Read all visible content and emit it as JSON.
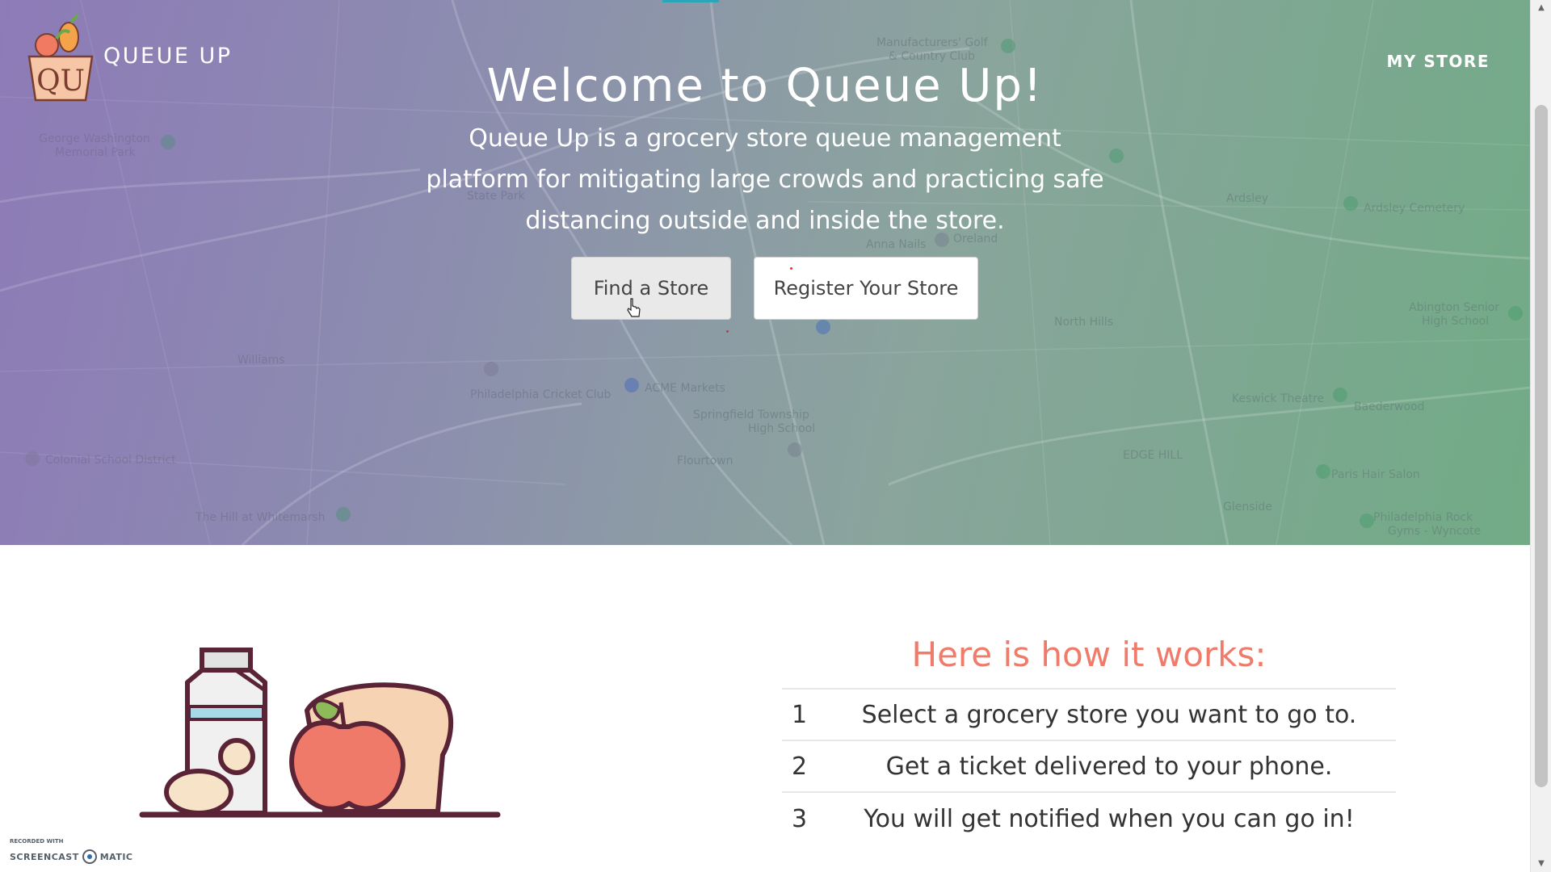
{
  "brand": {
    "name": "QUEUE UP",
    "logo_text": "QU"
  },
  "nav": {
    "my_store": "MY STORE"
  },
  "hero": {
    "title": "Welcome to Queue Up!",
    "description_lines": [
      "Queue Up is a grocery store queue management",
      "platform for mitigating large crowds and practicing safe",
      "distancing outside and inside the store."
    ],
    "buttons": {
      "find": "Find a Store",
      "register": "Register Your Store"
    }
  },
  "map_labels": [
    "Manufacturers' Golf & Country Club",
    "George Washington Memorial Park",
    "State Park",
    "Anna Nails",
    "Oreland",
    "Ardsley",
    "Ardsley Cemetery",
    "North Hills",
    "Abington Senior High School",
    "Williams",
    "Philadelphia Cricket Club",
    "ACME Markets",
    "Springfield Township High School",
    "Keswick Theatre",
    "Baederwood",
    "Colonial School District",
    "Flourtown",
    "EDGE HILL",
    "Paris Hair Salon",
    "Glenside",
    "The Hill at Whitemarsh",
    "Philadelphia Rock Gyms - Wyncote"
  ],
  "how_it_works": {
    "title": "Here is how it works:",
    "steps": [
      {
        "num": "1",
        "text": "Select a grocery store you want to go to."
      },
      {
        "num": "2",
        "text": "Get a ticket delivered to your phone."
      },
      {
        "num": "3",
        "text": "You will get notified when you can go in!"
      }
    ]
  },
  "watermark": {
    "top": "RECORDED WITH",
    "left": "SCREENCAST",
    "right": "MATIC"
  },
  "colors": {
    "accent": "#ef7b6a",
    "hero_purple": "#8e82b4",
    "hero_green": "#78ab8a",
    "teal_bar": "#2aa6b8"
  },
  "icons": [
    "queue-up-logo-icon",
    "pointer-cursor-icon",
    "grocery-illustration",
    "map-pin-icon",
    "scroll-up-arrow-icon",
    "scroll-down-arrow-icon"
  ]
}
